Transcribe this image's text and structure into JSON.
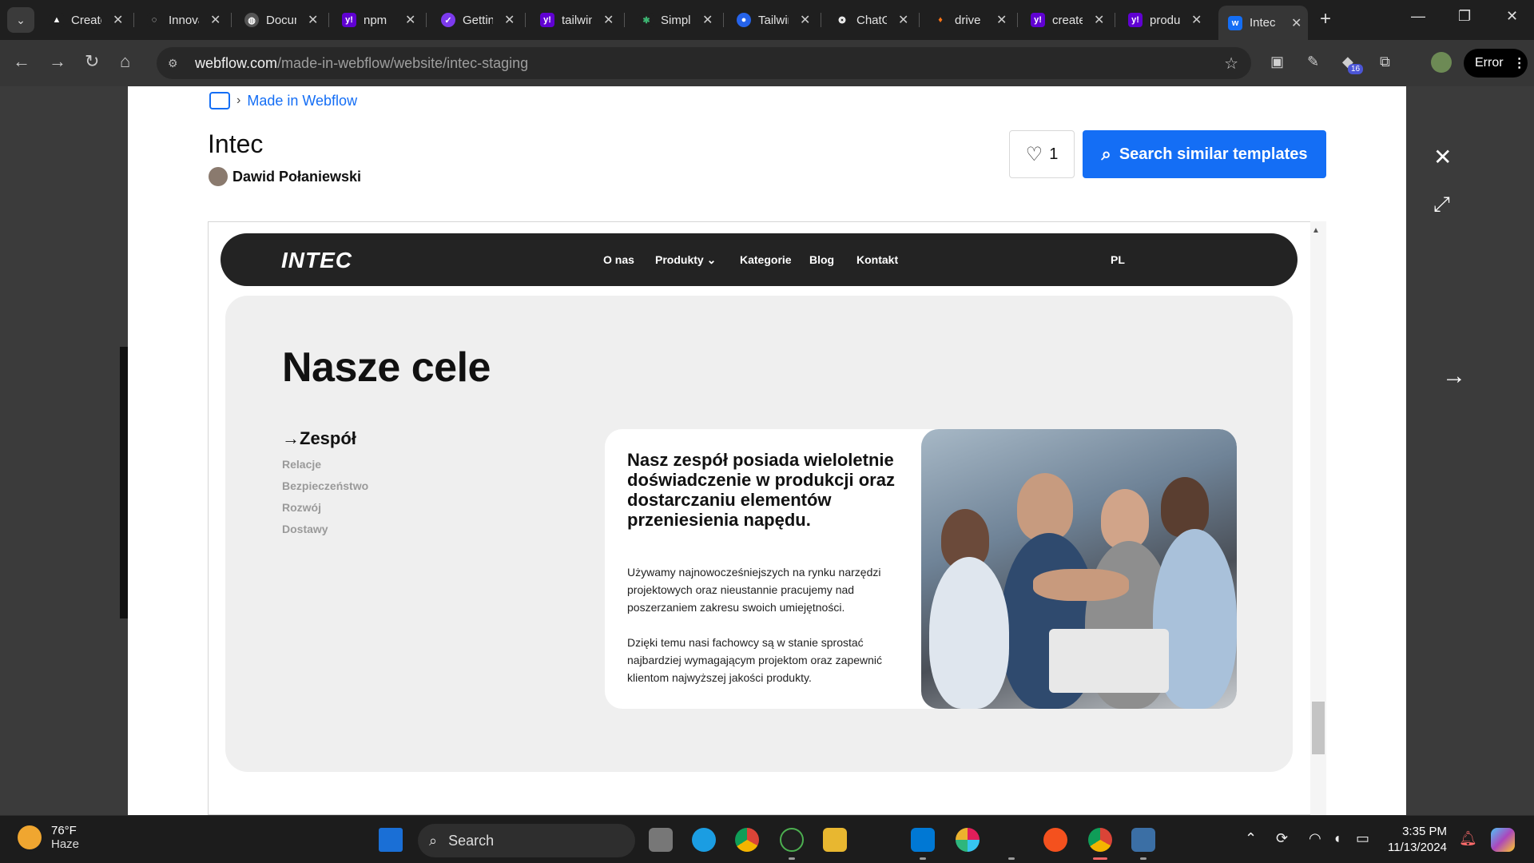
{
  "browser": {
    "tabs": [
      {
        "title": "Create",
        "icon": "triangle-icon",
        "color": "#1f1f1f"
      },
      {
        "title": "Innovate",
        "icon": "bulb-icon",
        "color": "#1f1f1f"
      },
      {
        "title": "Documentation",
        "icon": "globe-icon",
        "color": "#555555"
      },
      {
        "title": "npm",
        "icon": "yahoo-icon",
        "color": "#6001d2"
      },
      {
        "title": "Getting",
        "icon": "check-icon",
        "color": "#7c3aed"
      },
      {
        "title": "tailwind",
        "icon": "yahoo-icon",
        "color": "#6001d2"
      },
      {
        "title": "Simple",
        "icon": "gear-icon",
        "color": "#1f1f1f"
      },
      {
        "title": "Tailwind",
        "icon": "circle-icon",
        "color": "#2563eb"
      },
      {
        "title": "ChatGPT",
        "icon": "openai-icon",
        "color": "#1f1f1f"
      },
      {
        "title": "drive",
        "icon": "fire-icon",
        "color": "#1f1f1f"
      },
      {
        "title": "create",
        "icon": "yahoo-icon",
        "color": "#6001d2"
      },
      {
        "title": "products",
        "icon": "yahoo-icon",
        "color": "#6001d2"
      },
      {
        "title": "Intec",
        "icon": "webflow-icon",
        "color": "#146ef5"
      }
    ],
    "url_host": "webflow.com",
    "url_path": "/made-in-webflow/website/intec-staging",
    "extension_badge": "16",
    "profile_status": "Error"
  },
  "page": {
    "breadcrumb": "Made in Webflow",
    "title": "Intec",
    "author": "Dawid Połaniewski",
    "likes": "1",
    "search_button": "Search similar templates"
  },
  "preview": {
    "logo": "INTEC",
    "nav": [
      "O nas",
      "Produkty",
      "Kategorie",
      "Blog",
      "Kontakt"
    ],
    "lang": "PL",
    "heading": "Nasze cele",
    "side_active": "Zespół",
    "side_items": [
      "Relacje",
      "Bezpieczeństwo",
      "Rozwój",
      "Dostawy"
    ],
    "card_heading": "Nasz zespół posiada wieloletnie doświadczenie w produkcji oraz dostarczaniu elementów przeniesienia napędu.",
    "card_p1": "Używamy najnowocześniejszych na rynku narzędzi projektowych oraz nieustannie pracujemy nad poszerzaniem zakresu swoich umiejętności.",
    "card_p2": "Dzięki temu nasi fachowcy są w stanie sprostać najbardziej wymagającym projektom oraz zapewnić klientom najwyższej jakości produkty."
  },
  "taskbar": {
    "temp": "76°F",
    "weather": "Haze",
    "search_placeholder": "Search",
    "time": "3:35 PM",
    "date": "11/13/2024"
  },
  "colors": {
    "accent": "#146ef5",
    "nav_dark": "#232323",
    "hero_bg": "#efefef"
  }
}
